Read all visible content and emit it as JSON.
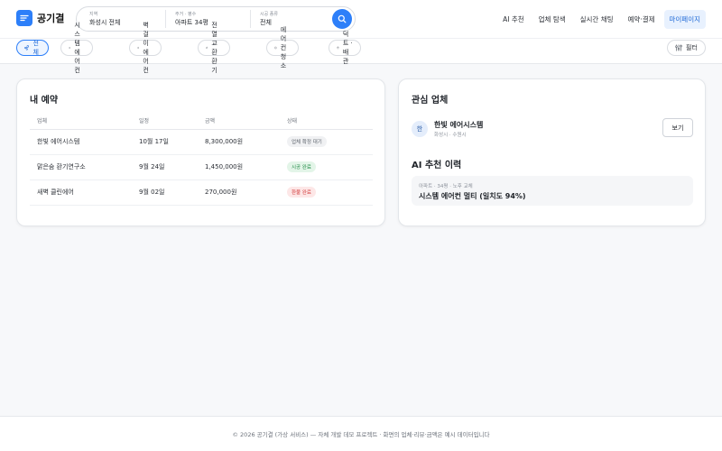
{
  "app": {
    "name": "공기결",
    "logo_icon": "chat-lines-icon",
    "brand_color": "#2d7ff9"
  },
  "search": {
    "fields": [
      {
        "label": "지역",
        "value": "화성시 전체"
      },
      {
        "label": "주거 · 평수",
        "value": "아파트 34평"
      },
      {
        "label": "시공 종류",
        "value": "전체"
      }
    ],
    "button_icon": "search-icon"
  },
  "nav": {
    "items": [
      {
        "label": "AI 추천",
        "active": false
      },
      {
        "label": "업체 탐색",
        "active": false
      },
      {
        "label": "실시간 채팅",
        "active": false
      },
      {
        "label": "예약·결제",
        "active": false
      },
      {
        "label": "마이페이지",
        "active": true
      }
    ]
  },
  "categories": {
    "items": [
      {
        "label": "전체",
        "icon": "wind-icon",
        "active": true
      },
      {
        "label": "시스템 에어컨",
        "icon": "grid-dots-icon",
        "active": false
      },
      {
        "label": "벽걸이 에어컨",
        "icon": "sparkle-icon",
        "active": false
      },
      {
        "label": "전열교환 환기",
        "icon": "wind-icon",
        "active": false
      },
      {
        "label": "에어컨 청소",
        "icon": "check-circle-icon",
        "active": false
      },
      {
        "label": "덕트 · 배관",
        "icon": "location-pin-icon",
        "active": false
      }
    ],
    "filter_label": "필터",
    "filter_icon": "sliders-icon"
  },
  "reservations": {
    "title": "내 예약",
    "columns": [
      "업체",
      "일정",
      "금액",
      "상태"
    ],
    "rows": [
      {
        "vendor": "한빛 에어시스템",
        "date": "10월 17일",
        "amount": "8,300,000원",
        "status": "업체 확정 대기",
        "status_type": "pending"
      },
      {
        "vendor": "맑은숨 환기연구소",
        "date": "9월 24일",
        "amount": "1,450,000원",
        "status": "시공 완료",
        "status_type": "done"
      },
      {
        "vendor": "새벽 클린에어",
        "date": "9월 02일",
        "amount": "270,000원",
        "status": "환불 완료",
        "status_type": "refund"
      }
    ],
    "status_colors": {
      "pending": {
        "bg": "#f0f1f3",
        "fg": "#5b616a"
      },
      "done": {
        "bg": "#e3f5e8",
        "fg": "#1f8a45"
      },
      "refund": {
        "bg": "#fde7e7",
        "fg": "#d23a3a"
      }
    }
  },
  "favorites": {
    "title": "관심 업체",
    "vendor": {
      "avatar": "한",
      "name": "한빛 에어시스템",
      "location": "화성시 · 수원시",
      "button_label": "보기"
    }
  },
  "ai_history": {
    "title": "AI 추천 이력",
    "item": {
      "meta": "아파트 · 34평 · 노후 교체",
      "result": "시스템 에어컨 멀티 (일치도 94%)"
    }
  },
  "footer": {
    "text": "© 2026 공기결 (가상 서비스) — 자체 개발 데모 프로젝트 · 화면의 업체·리뷰·금액은 예시 데이터입니다"
  }
}
